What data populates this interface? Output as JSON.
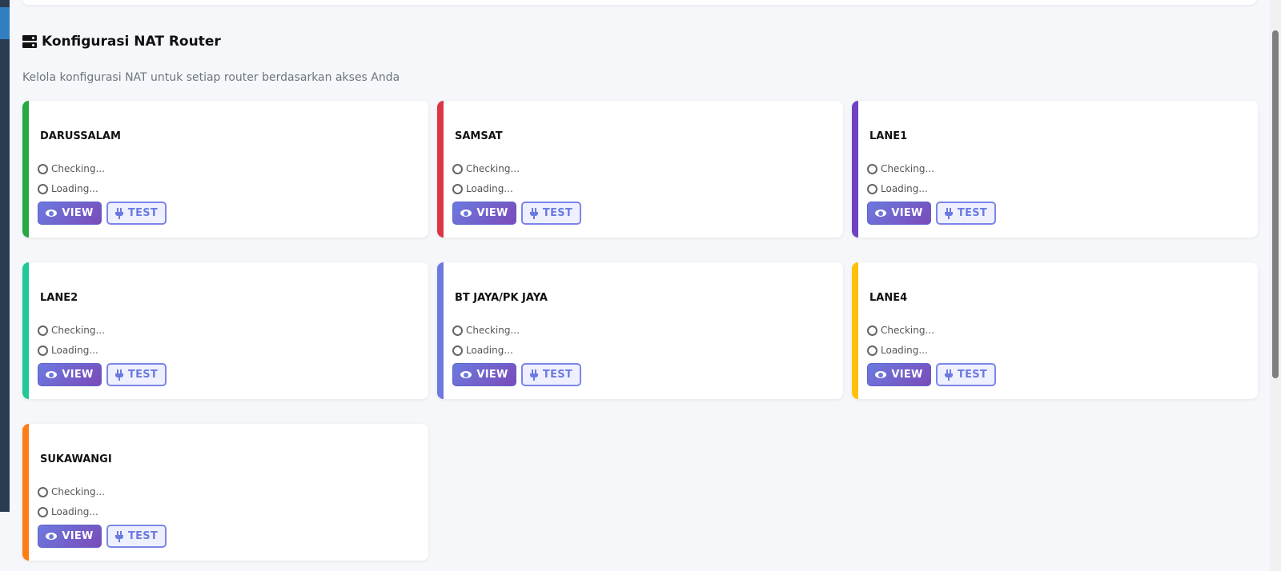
{
  "section": {
    "title": "Konfigurasi NAT Router",
    "subtitle": "Kelola konfigurasi NAT untuk setiap router berdasarkan akses Anda"
  },
  "routers": [
    {
      "name": "DARUSSALAM",
      "color": "#28a745",
      "status": "Checking...",
      "info": "Loading...",
      "view_label": "VIEW",
      "test_label": "TEST"
    },
    {
      "name": "SAMSAT",
      "color": "#dc3545",
      "status": "Checking...",
      "info": "Loading...",
      "view_label": "VIEW",
      "test_label": "TEST"
    },
    {
      "name": "LANE1",
      "color": "#6f42c1",
      "status": "Checking...",
      "info": "Loading...",
      "view_label": "VIEW",
      "test_label": "TEST"
    },
    {
      "name": "LANE2",
      "color": "#20c997",
      "status": "Checking...",
      "info": "Loading...",
      "view_label": "VIEW",
      "test_label": "TEST"
    },
    {
      "name": "BT JAYA/PK JAYA",
      "color": "#6c7ae0",
      "status": "Checking...",
      "info": "Loading...",
      "view_label": "VIEW",
      "test_label": "TEST"
    },
    {
      "name": "LANE4",
      "color": "#ffc107",
      "status": "Checking...",
      "info": "Loading...",
      "view_label": "VIEW",
      "test_label": "TEST"
    },
    {
      "name": "SUKAWANGI",
      "color": "#fd7e14",
      "status": "Checking...",
      "info": "Loading...",
      "view_label": "VIEW",
      "test_label": "TEST"
    }
  ]
}
